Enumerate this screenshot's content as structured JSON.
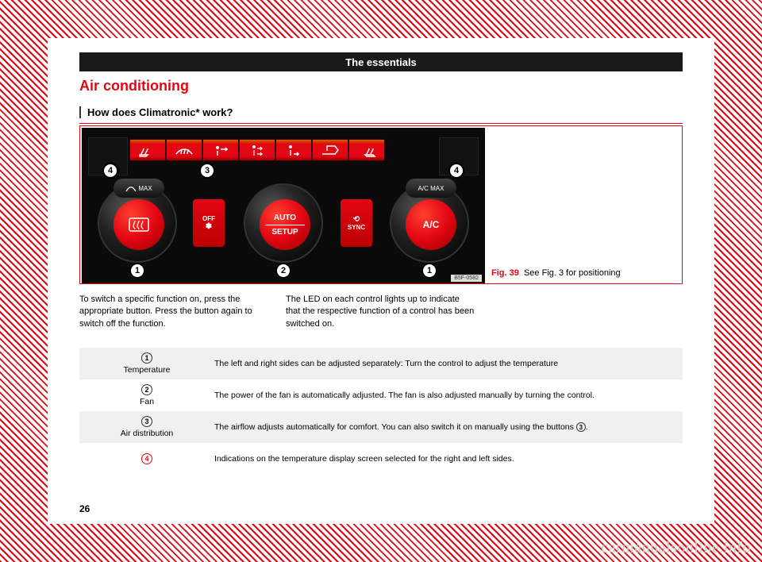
{
  "header": "The essentials",
  "section_title": "Air conditioning",
  "subsection_title": "How does Climatronic* work?",
  "figure": {
    "caption_label": "Fig. 39",
    "caption_text": "See Fig. 3 for positioning",
    "image_code": "B5F-0582",
    "callouts": {
      "one": "1",
      "two": "2",
      "three": "3",
      "four": "4"
    },
    "panel": {
      "off": "OFF",
      "sync": "SYNC",
      "center_top": "AUTO",
      "center_bottom": "SETUP",
      "right_top": "A/C MAX",
      "right_bottom": "A/C",
      "left_top": "MAX"
    }
  },
  "body": {
    "para1": "To switch a specific function on, press the appropriate button. Press the button again to switch off the function.",
    "para2": "The LED on each control lights up to indicate that the respective function of a control has been switched on."
  },
  "table": {
    "rows": [
      {
        "num": "1",
        "label": "Temperature",
        "desc": "The left and right sides can be adjusted separately: Turn the control to adjust the temperature"
      },
      {
        "num": "2",
        "label": "Fan",
        "desc": "The power of the fan is automatically adjusted. The fan is also adjusted manually by turning the control."
      },
      {
        "num": "3",
        "label": "Air distribution",
        "desc_pre": "The airflow adjusts automatically for comfort. You can also switch it on manually using the buttons ",
        "desc_ref": "3",
        "desc_post": "."
      },
      {
        "num": "4",
        "label": "",
        "desc": "Indications on the temperature display screen selected for the right and left sides."
      }
    ]
  },
  "page_number": "26",
  "watermark": "carmanualsonline.info"
}
